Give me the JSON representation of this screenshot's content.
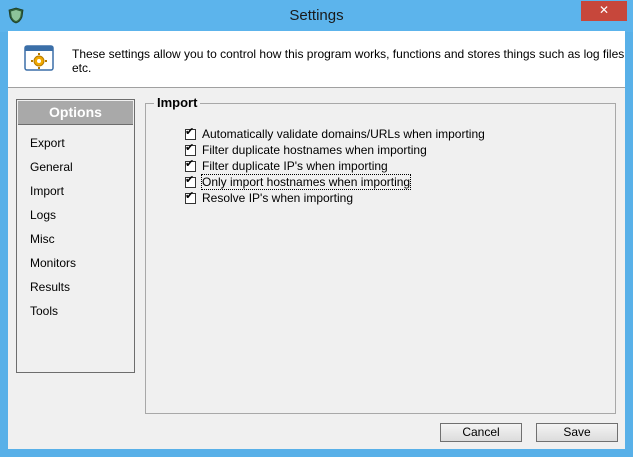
{
  "window": {
    "title": "Settings",
    "close_label": "✕",
    "icon": "shield-icon"
  },
  "header": {
    "icon": "settings-gear-window-icon",
    "description": "These settings allow you to control how this program works, functions and stores things such as log files etc."
  },
  "sidebar": {
    "title": "Options",
    "items": [
      {
        "label": "Export"
      },
      {
        "label": "General"
      },
      {
        "label": "Import"
      },
      {
        "label": "Logs"
      },
      {
        "label": "Misc"
      },
      {
        "label": "Monitors"
      },
      {
        "label": "Results"
      },
      {
        "label": "Tools"
      }
    ]
  },
  "panel": {
    "title": "Import",
    "options": [
      {
        "label": "Automatically validate domains/URLs when importing",
        "checked": true
      },
      {
        "label": "Filter duplicate hostnames when importing",
        "checked": true
      },
      {
        "label": "Filter duplicate IP's when importing",
        "checked": true
      },
      {
        "label": "Only import hostnames when importing",
        "checked": true,
        "focused": true
      },
      {
        "label": "Resolve IP's when importing",
        "checked": true
      }
    ]
  },
  "buttons": {
    "cancel": "Cancel",
    "save": "Save"
  },
  "colors": {
    "title_bar": "#5cb4ec",
    "close_button": "#c7473b",
    "sidebar_header": "#a9a9a9",
    "client_bg": "#f0f0f0"
  }
}
